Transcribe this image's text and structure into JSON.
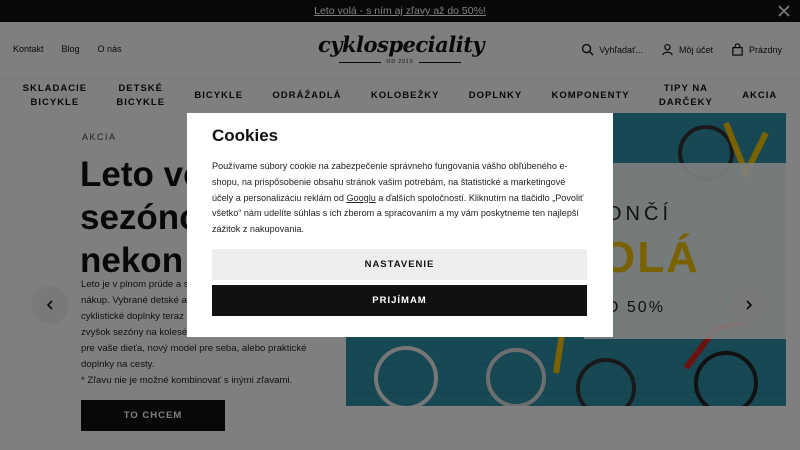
{
  "topbar": {
    "promo_link": "Leto volá - s ním aj zľavy až do 50%!",
    "close_icon": "close-icon"
  },
  "header": {
    "links": [
      "Kontakt",
      "Blog",
      "O nás"
    ],
    "logo": {
      "word": "cyklospeciality",
      "sub": "OD 2010"
    },
    "search_label": "Vyhľadať...",
    "account_label": "Môj účet",
    "cart_label": "Prázdny",
    "icons": [
      "search-icon",
      "user-icon",
      "bag-icon"
    ]
  },
  "nav": [
    [
      "SKLADACIE",
      "BICYKLE"
    ],
    [
      "DETSKÉ",
      "BICYKLE"
    ],
    [
      "BICYKLE"
    ],
    [
      "ODRÁŽADLÁ"
    ],
    [
      "KOLOBEŽKY"
    ],
    [
      "DOPLNKY"
    ],
    [
      "KOMPONENTY"
    ],
    [
      "TIPY NA",
      "DARČEKY"
    ],
    [
      "AKCIA"
    ]
  ],
  "hero": {
    "label": "AKCIA",
    "title_lines": [
      "Leto vo",
      "sezónc",
      "nekon"
    ],
    "text_lines": [
      "Leto je v plnom prúde a s",
      "nákup. Vybrané detské a",
      "cyklistické doplnky teraz",
      "zvyšok sezóny na koleséc",
      "pre vaše dieťa, nový model pre seba, alebo praktické",
      "doplnky na cesty.",
      "* Zľavu nie je možné kombinovať s inými zľavami."
    ],
    "cta": "TO CHCEM",
    "banner": {
      "line1": "ONČÍ",
      "line2": "OLÁ",
      "line3": "O 50%"
    },
    "arrows": [
      "chevron-left-icon",
      "chevron-right-icon"
    ]
  },
  "cookie": {
    "title": "Cookies",
    "text_before": "Používame súbory cookie na zabezpečenie správneho fungovania vášho obľúbeného e-shopu, na prispôsobenie obsahu stránok vašim potrebám, na štatistické a marketingové účely a personalizáciu reklám od ",
    "link": "Googlu",
    "text_after": " a ďalších spoločností. Kliknutím na tlačidlo „Povoliť všetko“ nám udelíte súhlas s ich zberom a spracovaním a my vám poskytneme ten najlepší zážitok z nakupovania.",
    "settings_button": "NASTAVENIE",
    "accept_button": "PRIJÍMAM"
  },
  "colors": {
    "accent": "#f4c400",
    "dark": "#111111",
    "banner": "#2e8fa5"
  }
}
